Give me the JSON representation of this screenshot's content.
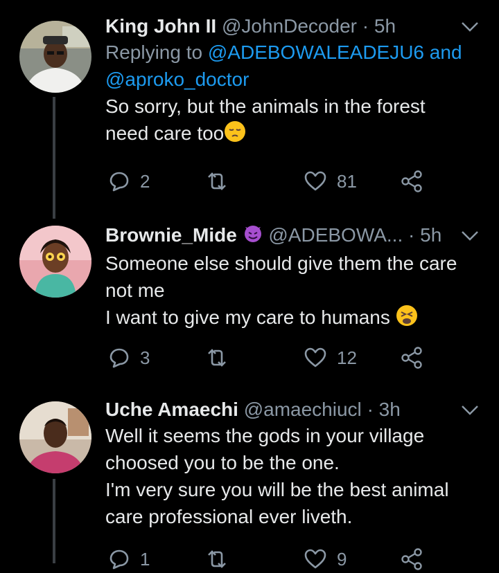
{
  "tweets": [
    {
      "name": "King John II",
      "handle": "@JohnDecoder",
      "sep": "·",
      "time": "5h",
      "replying_label": "Replying to",
      "replying_to_1": "@ADEBOWALEADEJU6",
      "replying_and": "and",
      "replying_to_2": "@aproko_doctor",
      "text_lines": [
        "So sorry, but the animals in the forest",
        "need care too"
      ],
      "emoji_end": "pensive-face",
      "replies": "2",
      "retweets": "",
      "likes": "81"
    },
    {
      "name": "Brownie_Mide",
      "badge_icon": "smiling-imp",
      "handle": "@ADEBOWA...",
      "sep": "·",
      "time": "5h",
      "text_lines": [
        "Someone else should give them the care",
        "not me",
        "I want to give my care to humans"
      ],
      "emoji_end": "weary-face",
      "replies": "3",
      "retweets": "",
      "likes": "12"
    },
    {
      "name": "Uche Amaechi",
      "handle": "@amaechiucl",
      "sep": "·",
      "time": "3h",
      "text_lines": [
        "Well it seems the gods in your village",
        "choosed you to be the one.",
        "I'm very sure you will be the best animal",
        "care professional ever liveth."
      ],
      "replies": "1",
      "retweets": "",
      "likes": "9"
    }
  ],
  "colors": {
    "background": "#000000",
    "text": "#e7e9ea",
    "muted": "#8b98a5",
    "link": "#1d9bf0",
    "thread_line": "#3a3f44"
  }
}
